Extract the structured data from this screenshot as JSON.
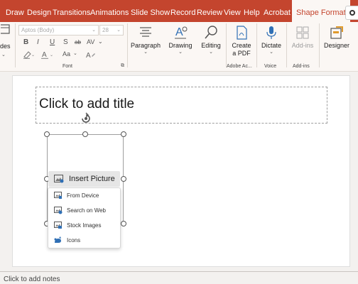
{
  "tabs": [
    {
      "label": "Draw"
    },
    {
      "label": "Design"
    },
    {
      "label": "Transitions"
    },
    {
      "label": "Animations"
    },
    {
      "label": "Slide Show"
    },
    {
      "label": "Record"
    },
    {
      "label": "Review"
    },
    {
      "label": "View"
    },
    {
      "label": "Help"
    },
    {
      "label": "Acrobat"
    },
    {
      "label": "Shape Format"
    }
  ],
  "ribbon": {
    "slides_partial": "des",
    "font": {
      "name": "Aptos (Body)",
      "size": "28",
      "group_label": "Font",
      "bold": "B",
      "italic": "I",
      "underline": "U",
      "strikethrough": "S",
      "shadow": "ab",
      "spacing": "AV",
      "change_case": "Aa"
    },
    "paragraph": {
      "label": "Paragraph"
    },
    "drawing": {
      "label": "Drawing"
    },
    "editing": {
      "label": "Editing"
    },
    "create_pdf": {
      "label_1": "Create",
      "label_2": "a PDF"
    },
    "dictate": {
      "label": "Dictate"
    },
    "addins": {
      "label": "Add-ins"
    },
    "designer": {
      "label": "Designer"
    },
    "group_labels": {
      "adobe": "Adobe Ac...",
      "voice": "Voice",
      "addins": "Add-ins"
    }
  },
  "slide": {
    "title_placeholder": "Click to add title",
    "insert_picture": "Insert Picture",
    "menu": [
      {
        "label": "From Device"
      },
      {
        "label": "Search on Web"
      },
      {
        "label": "Stock Images"
      },
      {
        "label": "Icons"
      }
    ]
  },
  "notes": {
    "placeholder": "Click to add notes"
  },
  "colors": {
    "accent": "#c4452e",
    "ribbon_bg": "#fbf7f4",
    "icon_blue": "#2f6fb5"
  }
}
